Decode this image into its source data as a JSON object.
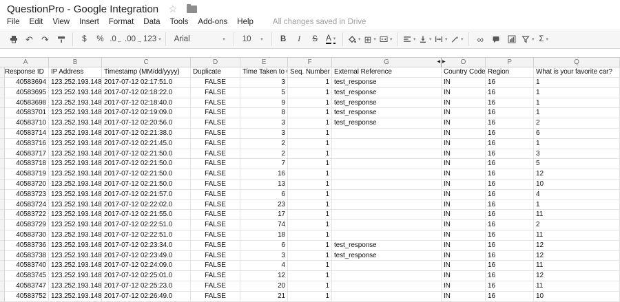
{
  "doc": {
    "title": "QuestionPro - Google Integration",
    "status": "All changes saved in Drive",
    "menus": [
      "File",
      "Edit",
      "View",
      "Insert",
      "Format",
      "Data",
      "Tools",
      "Add-ons",
      "Help"
    ]
  },
  "toolbar": {
    "items": [
      {
        "name": "print-button",
        "icon": "printer-icon"
      },
      {
        "name": "undo-button",
        "icon": "undo-icon"
      },
      {
        "name": "redo-button",
        "icon": "redo-icon"
      },
      {
        "name": "paint-format-button",
        "icon": "paint-roller-icon"
      },
      {
        "type": "sep"
      },
      {
        "name": "format-currency-button",
        "label": "$"
      },
      {
        "name": "format-percent-button",
        "label": "%"
      },
      {
        "name": "decrease-decimal-button",
        "label": ".0",
        "arrow": "←"
      },
      {
        "name": "increase-decimal-button",
        "label": ".00",
        "arrow": "→"
      },
      {
        "name": "more-formats-button",
        "label": "123",
        "caret": true
      },
      {
        "type": "sep"
      },
      {
        "name": "font-family-select",
        "label": "Arial",
        "caret": true,
        "wide": 86
      },
      {
        "type": "sep"
      },
      {
        "name": "font-size-select",
        "label": "10",
        "caret": true,
        "wide": 42
      },
      {
        "type": "sep"
      },
      {
        "name": "bold-button",
        "label": "B",
        "cls": "bold"
      },
      {
        "name": "italic-button",
        "label": "I",
        "cls": "italic"
      },
      {
        "name": "strikethrough-button",
        "label": "S",
        "cls": "strike"
      },
      {
        "name": "text-color-button",
        "label": "A",
        "cls": "acolor",
        "caret": true
      },
      {
        "type": "sep"
      },
      {
        "name": "fill-color-button",
        "icon": "bucket-icon",
        "caret": true
      },
      {
        "name": "borders-button",
        "icon": "borders-icon",
        "caret": true
      },
      {
        "name": "merge-cells-button",
        "icon": "merge-icon",
        "caret": true
      },
      {
        "type": "sep"
      },
      {
        "name": "horizontal-align-button",
        "icon": "align-left-icon",
        "caret": true
      },
      {
        "name": "vertical-align-button",
        "icon": "valign-icon",
        "caret": true
      },
      {
        "name": "text-wrap-button",
        "icon": "wrap-icon",
        "caret": true
      },
      {
        "name": "text-rotation-button",
        "icon": "rotate-icon",
        "caret": true
      },
      {
        "type": "sep"
      },
      {
        "name": "insert-link-button",
        "icon": "link-icon"
      },
      {
        "name": "insert-comment-button",
        "icon": "comment-icon"
      },
      {
        "name": "insert-chart-button",
        "icon": "chart-icon"
      },
      {
        "name": "filter-button",
        "icon": "filter-icon",
        "caret": true
      },
      {
        "name": "functions-button",
        "label": "Σ",
        "caret": true
      }
    ]
  },
  "sheet": {
    "columns": [
      {
        "letter": "A",
        "header": "Response ID",
        "align": "ar"
      },
      {
        "letter": "B",
        "header": "IP Address",
        "align": "al"
      },
      {
        "letter": "C",
        "header": "Timestamp (MM/dd/yyyy)",
        "align": "al"
      },
      {
        "letter": "D",
        "header": "Duplicate",
        "align": "ac"
      },
      {
        "letter": "E",
        "header": "Time Taken to Co",
        "align": "ar"
      },
      {
        "letter": "F",
        "header": "Seq. Number",
        "align": "ar"
      },
      {
        "letter": "G",
        "header": "External Reference",
        "align": "al"
      },
      {
        "letter": "O",
        "header": "Country Code",
        "align": "al"
      },
      {
        "letter": "P",
        "header": "Region",
        "align": "al"
      },
      {
        "letter": "Q",
        "header": "What is your favorite car?",
        "align": "al"
      }
    ],
    "rows": [
      [
        "40583694",
        "123.252.193.148",
        "2017-07-12 02:17:51.0",
        "FALSE",
        "3",
        "1",
        "test_response",
        "IN",
        "16",
        "1"
      ],
      [
        "40583695",
        "123.252.193.148",
        "2017-07-12 02:18:22.0",
        "FALSE",
        "5",
        "1",
        "test_response",
        "IN",
        "16",
        "1"
      ],
      [
        "40583698",
        "123.252.193.148",
        "2017-07-12 02:18:40.0",
        "FALSE",
        "9",
        "1",
        "test_response",
        "IN",
        "16",
        "1"
      ],
      [
        "40583701",
        "123.252.193.148",
        "2017-07-12 02:19:09.0",
        "FALSE",
        "8",
        "1",
        "test_response",
        "IN",
        "16",
        "1"
      ],
      [
        "40583710",
        "123.252.193.148",
        "2017-07-12 02:20:56.0",
        "FALSE",
        "3",
        "1",
        "test_response",
        "IN",
        "16",
        "2"
      ],
      [
        "40583714",
        "123.252.193.148",
        "2017-07-12 02:21:38.0",
        "FALSE",
        "3",
        "1",
        "",
        "IN",
        "16",
        "6"
      ],
      [
        "40583716",
        "123.252.193.148",
        "2017-07-12 02:21:45.0",
        "FALSE",
        "2",
        "1",
        "",
        "IN",
        "16",
        "1"
      ],
      [
        "40583717",
        "123.252.193.148",
        "2017-07-12 02:21:50.0",
        "FALSE",
        "2",
        "1",
        "",
        "IN",
        "16",
        "3"
      ],
      [
        "40583718",
        "123.252.193.148",
        "2017-07-12 02:21:50.0",
        "FALSE",
        "7",
        "1",
        "",
        "IN",
        "16",
        "5"
      ],
      [
        "40583719",
        "123.252.193.148",
        "2017-07-12 02:21:50.0",
        "FALSE",
        "16",
        "1",
        "",
        "IN",
        "16",
        "12"
      ],
      [
        "40583720",
        "123.252.193.148",
        "2017-07-12 02:21:50.0",
        "FALSE",
        "13",
        "1",
        "",
        "IN",
        "16",
        "10"
      ],
      [
        "40583723",
        "123.252.193.148",
        "2017-07-12 02:21:57.0",
        "FALSE",
        "6",
        "1",
        "",
        "IN",
        "16",
        "4"
      ],
      [
        "40583724",
        "123.252.193.148",
        "2017-07-12 02:22:02.0",
        "FALSE",
        "23",
        "1",
        "",
        "IN",
        "16",
        "1"
      ],
      [
        "40583722",
        "123.252.193.148",
        "2017-07-12 02:21:55.0",
        "FALSE",
        "17",
        "1",
        "",
        "IN",
        "16",
        "11"
      ],
      [
        "40583729",
        "123.252.193.148",
        "2017-07-12 02:22:51.0",
        "FALSE",
        "74",
        "1",
        "",
        "IN",
        "16",
        "2"
      ],
      [
        "40583730",
        "123.252.193.148",
        "2017-07-12 02:22:51.0",
        "FALSE",
        "18",
        "1",
        "",
        "IN",
        "16",
        "11"
      ],
      [
        "40583736",
        "123.252.193.148",
        "2017-07-12 02:23:34.0",
        "FALSE",
        "6",
        "1",
        "test_response",
        "IN",
        "16",
        "12"
      ],
      [
        "40583738",
        "123.252.193.148",
        "2017-07-12 02:23:49.0",
        "FALSE",
        "3",
        "1",
        "test_response",
        "IN",
        "16",
        "12"
      ],
      [
        "40583740",
        "123.252.193.148",
        "2017-07-12 02:24:09.0",
        "FALSE",
        "4",
        "1",
        "",
        "IN",
        "16",
        "11"
      ],
      [
        "40583745",
        "123.252.193.148",
        "2017-07-12 02:25:01.0",
        "FALSE",
        "12",
        "1",
        "",
        "IN",
        "16",
        "12"
      ],
      [
        "40583747",
        "123.252.193.148",
        "2017-07-12 02:25:23.0",
        "FALSE",
        "20",
        "1",
        "",
        "IN",
        "16",
        "11"
      ],
      [
        "40583752",
        "123.252.193.148",
        "2017-07-12 02:26:49.0",
        "FALSE",
        "21",
        "1",
        "",
        "IN",
        "16",
        "10"
      ]
    ]
  }
}
